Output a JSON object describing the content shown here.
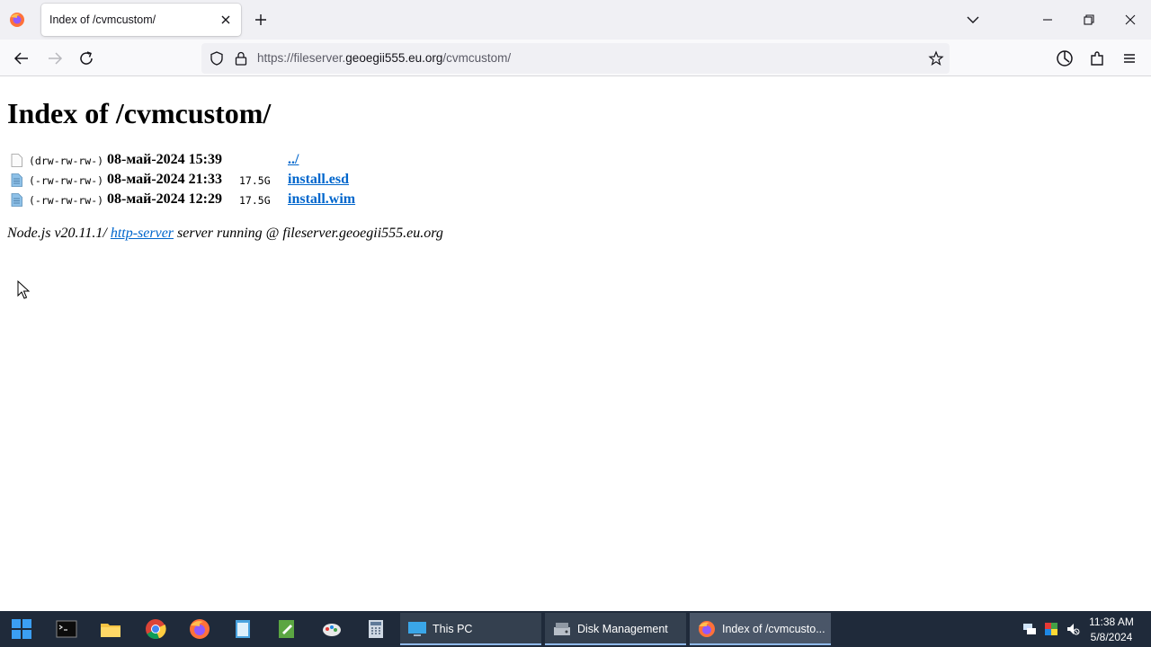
{
  "browser": {
    "tab": {
      "title": "Index of /cvmcustom/"
    },
    "url": {
      "scheme_prefix": "https://fileserver.",
      "host": "geoegii555.eu.org",
      "path": "/cvmcustom/"
    }
  },
  "page": {
    "heading": "Index of /cvmcustom/",
    "entries": [
      {
        "perm": "(drw-rw-rw-)",
        "date": "08-май-2024 15:39",
        "size": "",
        "name": "../",
        "icon": "folder-icon"
      },
      {
        "perm": "(-rw-rw-rw-)",
        "date": "08-май-2024 21:33",
        "size": "17.5G",
        "name": "install.esd",
        "icon": "file-icon"
      },
      {
        "perm": "(-rw-rw-rw-)",
        "date": "08-май-2024 12:29",
        "size": "17.5G",
        "name": "install.wim",
        "icon": "file-icon"
      }
    ],
    "footer": {
      "prefix": "Node.js v20.11.1/ ",
      "link": "http-server",
      "suffix": " server running @ fileserver.geoegii555.eu.org"
    }
  },
  "taskbar": {
    "windows": [
      {
        "label": "This PC",
        "icon": "monitor-icon"
      },
      {
        "label": "Disk Management",
        "icon": "disk-icon"
      },
      {
        "label": "Index of /cvmcusto...",
        "icon": "firefox-icon"
      }
    ],
    "clock": {
      "time": "11:38 AM",
      "date": "5/8/2024"
    }
  },
  "colors": {
    "link": "#0066cc",
    "taskbar": "#1f2a3a"
  }
}
